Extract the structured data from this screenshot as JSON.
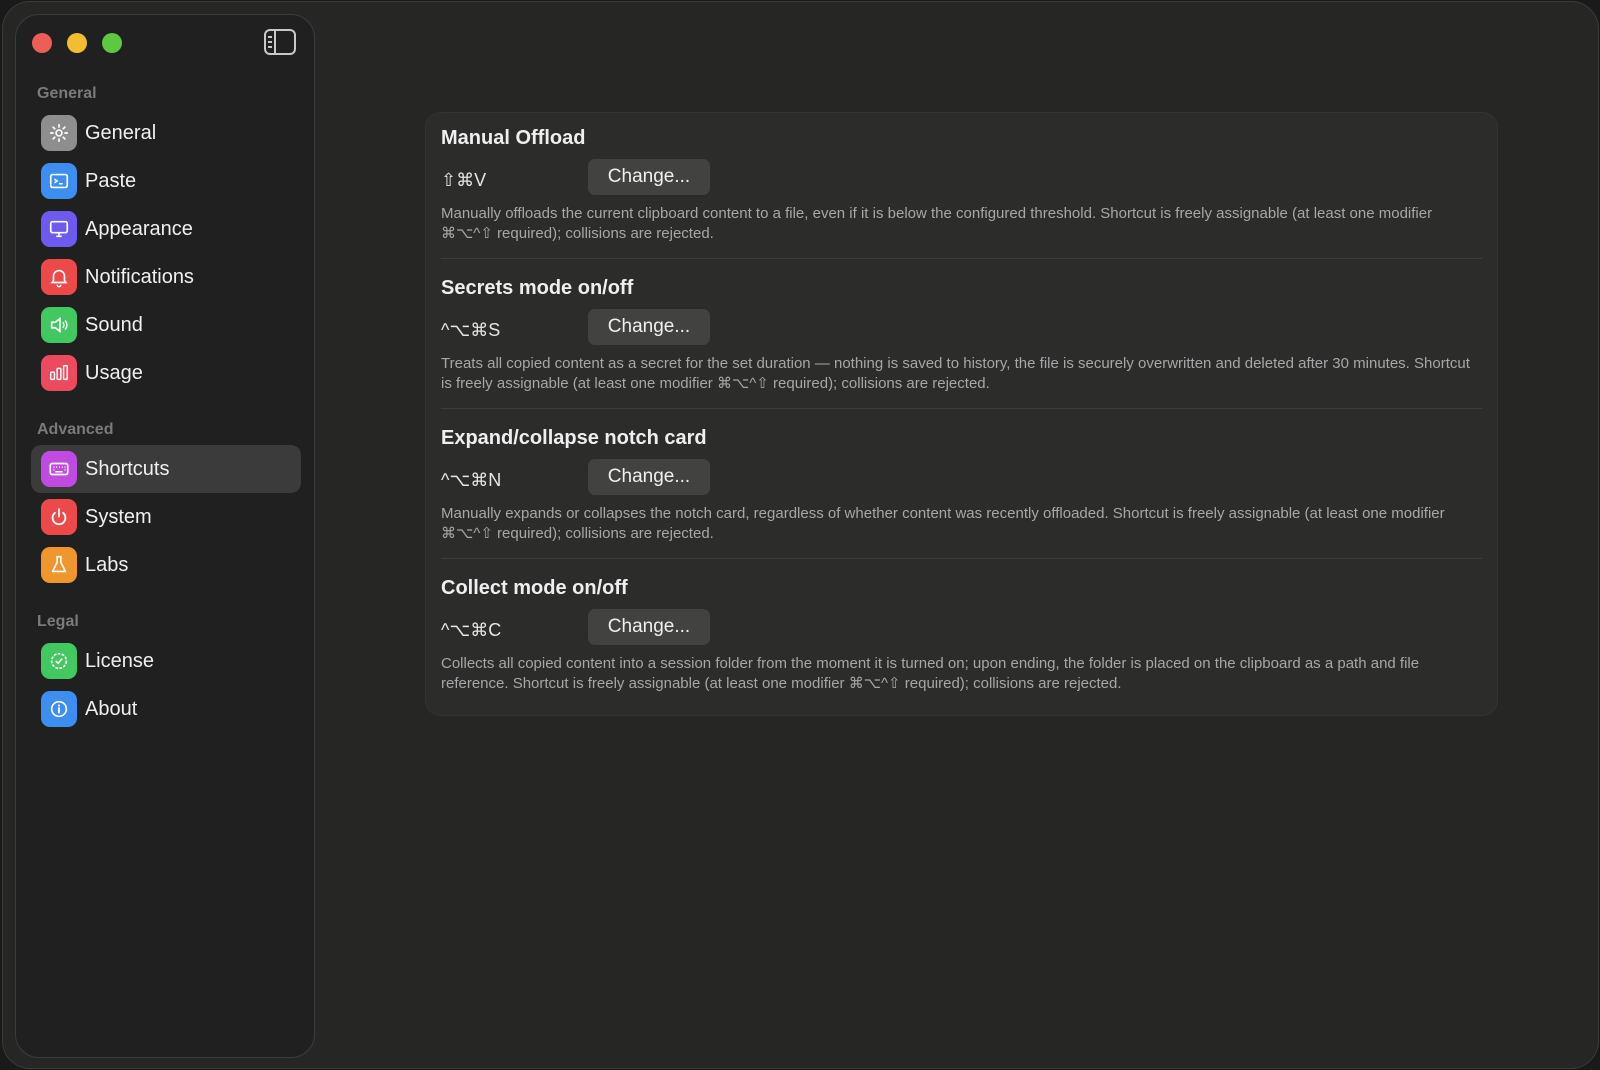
{
  "sidebar": {
    "sections": [
      {
        "label": "General"
      },
      {
        "label": "Advanced"
      },
      {
        "label": "Legal"
      }
    ],
    "items": [
      {
        "label": "General",
        "icon": "gear-icon",
        "color": "#8e8e8e"
      },
      {
        "label": "Paste",
        "icon": "terminal-icon",
        "color": "#3d8ef0"
      },
      {
        "label": "Appearance",
        "icon": "display-icon",
        "color": "#6d5bef"
      },
      {
        "label": "Notifications",
        "icon": "bell-icon",
        "color": "#ec4a4a"
      },
      {
        "label": "Sound",
        "icon": "speaker-icon",
        "color": "#43c760"
      },
      {
        "label": "Usage",
        "icon": "bar-chart-icon",
        "color": "#ec4a5e"
      },
      {
        "label": "Shortcuts",
        "icon": "keyboard-icon",
        "color": "#c04be0"
      },
      {
        "label": "System",
        "icon": "power-icon",
        "color": "#ec4a4a"
      },
      {
        "label": "Labs",
        "icon": "flask-icon",
        "color": "#f0962e"
      },
      {
        "label": "License",
        "icon": "checkmark-seal-icon",
        "color": "#43c760"
      },
      {
        "label": "About",
        "icon": "info-icon",
        "color": "#3d8ef0"
      }
    ],
    "active": "Shortcuts"
  },
  "shortcuts": [
    {
      "title": "Manual Offload",
      "keys": "⇧⌘V",
      "button": "Change...",
      "description": "Manually offloads the current clipboard content to a file, even if it is below the configured threshold. Shortcut is freely assignable (at least one modifier ⌘⌥^⇧ required); collisions are rejected."
    },
    {
      "title": "Secrets mode on/off",
      "keys": "^⌥⌘S",
      "button": "Change...",
      "description": "Treats all copied content as a secret for the set duration — nothing is saved to history, the file is securely overwritten and deleted after 30 minutes. Shortcut is freely assignable (at least one modifier ⌘⌥^⇧ required); collisions are rejected."
    },
    {
      "title": "Expand/collapse notch card",
      "keys": "^⌥⌘N",
      "button": "Change...",
      "description": "Manually expands or collapses the notch card, regardless of whether content was recently offloaded. Shortcut is freely assignable (at least one modifier ⌘⌥^⇧ required); collisions are rejected."
    },
    {
      "title": "Collect mode on/off",
      "keys": "^⌥⌘C",
      "button": "Change...",
      "description": "Collects all copied content into a session folder from the moment it is turned on; upon ending, the folder is placed on the clipboard as a path and file reference. Shortcut is freely assignable (at least one modifier ⌘⌥^⇧ required); collisions are rejected."
    }
  ]
}
